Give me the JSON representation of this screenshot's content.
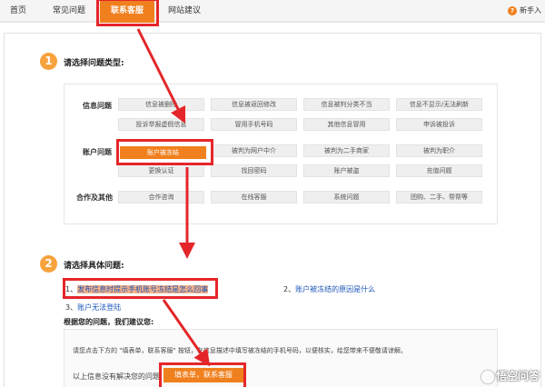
{
  "nav": {
    "items": [
      "首页",
      "常见问题",
      "联系客服",
      "网站建议"
    ],
    "active_index": 2,
    "newbie": "新手入"
  },
  "step1": {
    "number": "1",
    "title": "请选择问题类型:"
  },
  "categories": [
    {
      "label": "信息问题",
      "rows": [
        [
          "信息被删除",
          "信息被返回修改",
          "信息被判分类不当",
          "信息不显示/无法刷新"
        ],
        [
          "投诉举报虚假信息",
          "冒用手机号码",
          "其他信息冒用",
          "申诉被投诉"
        ]
      ]
    },
    {
      "label": "账户问题",
      "rows": [
        [
          "账户被冻结",
          "被判为网户中介",
          "被判为二手商家",
          "被判为职介"
        ],
        [
          "更换认证",
          "找回密码",
          "账户被盗",
          "充值问题"
        ]
      ]
    },
    {
      "label": "合作及其他",
      "rows": [
        [
          "合作咨询",
          "在线客服",
          "系统问题",
          "团购、二手、帮帮等"
        ]
      ]
    }
  ],
  "step2": {
    "number": "2",
    "title": "请选择具体问题:"
  },
  "questions": [
    {
      "num": "1、",
      "text": "发布信息时提示手机账号冻结是怎么回事"
    },
    {
      "num": "2、",
      "text": "账户被冻结的原因是什么"
    },
    {
      "num": "3、",
      "text": "账户无法登陆"
    }
  ],
  "advice": {
    "title": "根据您的问题，我们建议您:",
    "text": "请您点击下方的 \"填表单，联系客服\" 按钮，在信息描述中填写被冻结的手机号码，以便核实，给您带来不便敬请谅解。",
    "unresolved": "以上信息没有解决您的问题",
    "button": "填表单，联系客服"
  },
  "watermark": "悟空问答",
  "colors": {
    "accent": "#f0801e",
    "highlight_red": "#e4262a",
    "link": "#1a55b8"
  }
}
